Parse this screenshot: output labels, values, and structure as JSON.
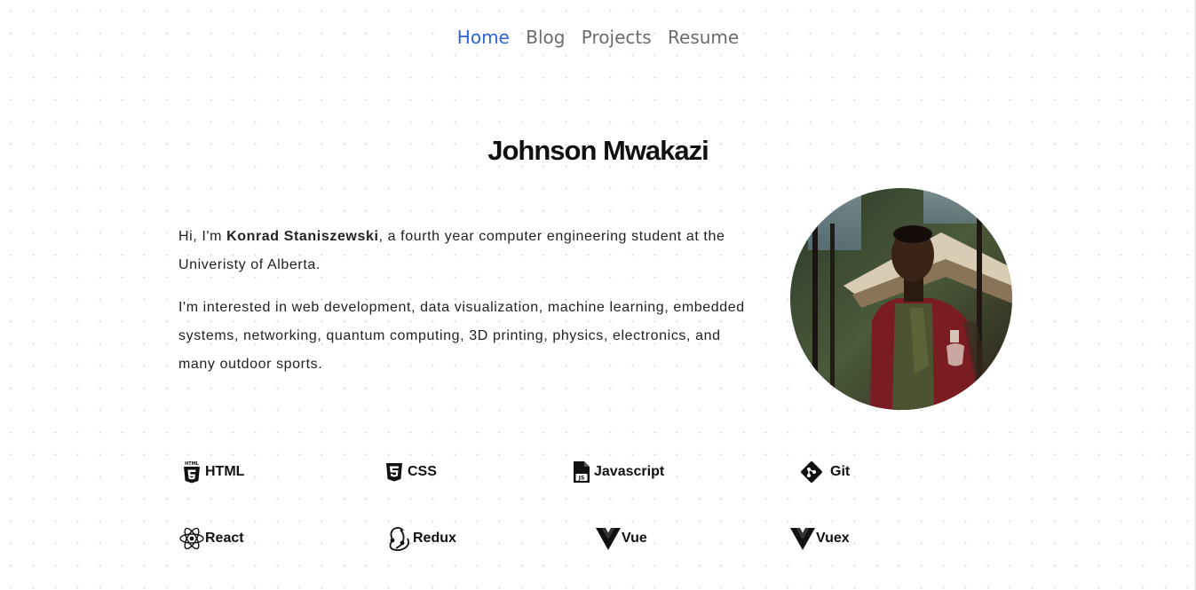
{
  "nav": {
    "items": [
      {
        "label": "Home",
        "active": true
      },
      {
        "label": "Blog",
        "active": false
      },
      {
        "label": "Projects",
        "active": false
      },
      {
        "label": "Resume",
        "active": false
      }
    ]
  },
  "header": {
    "title": "Johnson Mwakazi"
  },
  "bio": {
    "p1_prefix": "Hi, I'm ",
    "p1_name": "Konrad Staniszewski",
    "p1_suffix": ", a fourth year computer engineering student at the Univeristy of Alberta.",
    "p2": "I'm interested in web development, data visualization, machine learning, embedded systems, networking, quantum computing, 3D printing, physics, electronics, and many outdoor sports."
  },
  "skills": [
    {
      "label": "HTML",
      "icon": "html5-icon"
    },
    {
      "label": "CSS",
      "icon": "css3-icon"
    },
    {
      "label": "Javascript",
      "icon": "javascript-file-icon"
    },
    {
      "label": "Git",
      "icon": "git-icon"
    },
    {
      "label": "React",
      "icon": "react-icon"
    },
    {
      "label": "Redux",
      "icon": "redux-icon"
    },
    {
      "label": "Vue",
      "icon": "vue-icon"
    },
    {
      "label": "Vuex",
      "icon": "vue-icon"
    }
  ],
  "colors": {
    "nav_active": "#2b63d9",
    "nav_inactive": "#6b6b6b",
    "text": "#1a1a1a"
  }
}
